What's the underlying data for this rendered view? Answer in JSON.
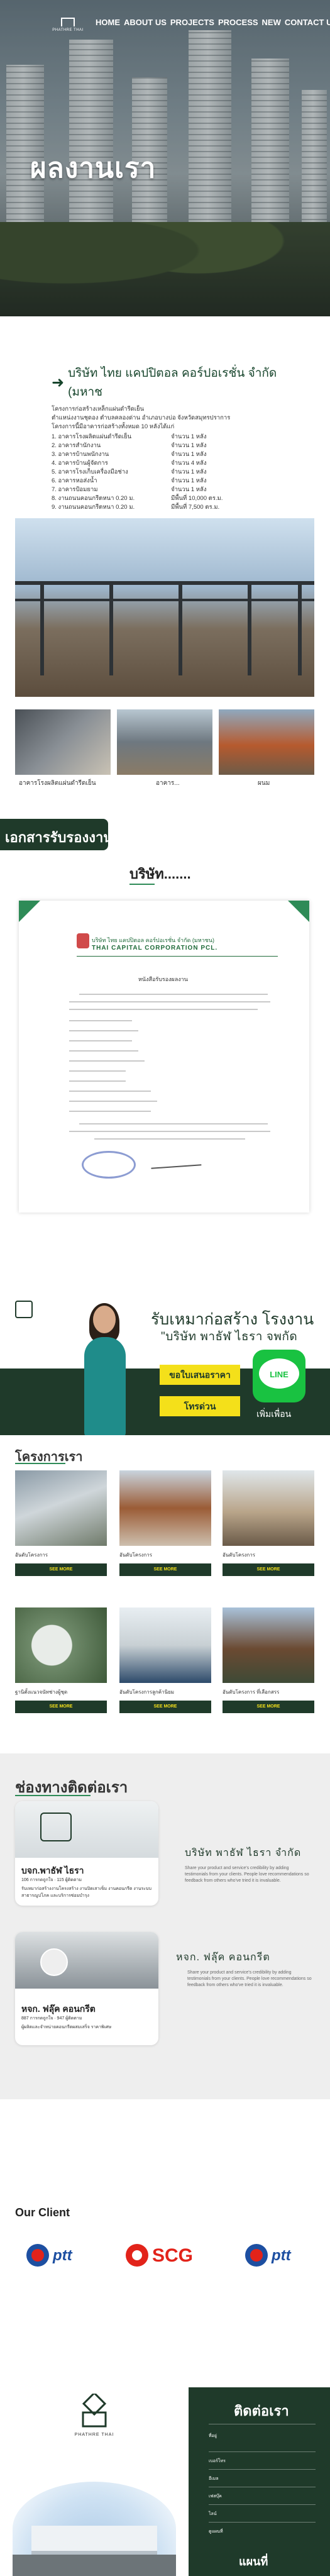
{
  "header": {
    "logo_text": "PHATHRE\nTHAI",
    "nav": [
      "HOME",
      "ABOUT US",
      "PROJECTS",
      "PROCESS",
      "NEW",
      "CONTACT US"
    ],
    "title": "ผลงานเรา"
  },
  "company": {
    "name": "บริษัท ไทย แคปปิตอล คอร์ปอเรชั่น จำกัด (มหาช",
    "lines": [
      "โครงการก่อสร้างเหล็กแผ่นดำรีดเย็น",
      "ตำแหน่งงานชุดอง ตำบลคลองด่าน อำเภอบางบ่อ จังหวัดสมุทรปราการ",
      "โครงการนี้มีอาคารก่อสร้างทั้งหมด 10 หลังได้แก่"
    ],
    "specs": [
      {
        "k": "1. อาคารโรงผลิตแผ่นดำรีดเย็น",
        "v": "จำนวน 1 หลัง"
      },
      {
        "k": "2. อาคารสำนักงาน",
        "v": "จำนวน 1 หลัง"
      },
      {
        "k": "3. อาคารบ้านพนักงาน",
        "v": "จำนวน 1 หลัง"
      },
      {
        "k": "4. อาคารบ้านผู้จัดการ",
        "v": "จำนวน 4 หลัง"
      },
      {
        "k": "5. อาคารโรงเก็บเครื่องมือช่าง",
        "v": "จำนวน 1 หลัง"
      },
      {
        "k": "6. อาคารหอส่งน้ำ",
        "v": "จำนวน 1 หลัง"
      },
      {
        "k": "7. อาคารป้อมยาม",
        "v": "จำนวน 1 หลัง"
      },
      {
        "k": "8. งานถนนคอนกรีตหนา 0.20 ม.",
        "v": "มีพื้นที่ 10,000 ตร.ม."
      },
      {
        "k": "9. งานถนนคอนกรีตหนา 0.20 ม.",
        "v": "มีพื้นที่ 7,500 ตร.ม."
      }
    ]
  },
  "gallery": {
    "captions": [
      "อาคารโรงผลิตแผ่นดำรีดเย็น",
      "อาคาร...",
      "ผนม"
    ]
  },
  "documents": {
    "banner": "เอกสารรับรองงาน",
    "subtitle": "บริษัท.......",
    "letter": {
      "company_th": "บริษัท ไทย แคปปิตอล คอร์ปอเรชั่น จำกัด (มหาชน)",
      "company_en": "THAI CAPITAL CORPORATION PCL.",
      "heading": "หนังสือรับรองผลงาน"
    }
  },
  "contact_banner": {
    "line1": "รับเหมาก่อสร้าง โรงงาน",
    "line2": "\"บริษัท พาธัฬ ไธรา จพกัด",
    "btn_quote": "ขอใบเสนอราคา",
    "btn_call": "โทรด่วน",
    "line_icon": "LINE",
    "line_sub": "เพิ่มเพื่อน"
  },
  "projects": {
    "title": "โครงการเรา",
    "btn_label": "SEE MORE",
    "items": [
      {
        "caption": "อันดับโครงการ"
      },
      {
        "caption": "อันดับโครงการ"
      },
      {
        "caption": "อันดับโครงการ"
      },
      {
        "caption": "ฐานิตั้งแนวจนัทช่างผู้ชุด"
      },
      {
        "caption": "อันดับโครงการลูกค้านิยม"
      },
      {
        "caption": "อันดับโครงการ ที่เลือกสรร"
      }
    ]
  },
  "contact_channels": {
    "title": "ช่องทางติดต่อเรา",
    "cards": [
      {
        "name": "บจก.พาธัฬ ไธรา",
        "stats": "106 การกดถูกใจ · 115 ผู้ติดตาม",
        "desc": "รับเหมาก่อสร้างงานโครงสร้าง งานปิดเสาเข็ม งานคอนกรีต งานระบบสาธารณูปโภค และบริการซ่อมบำรุง",
        "right_name": "บริษัท พาธัฬ ไธรา จำกัด",
        "right_desc": "Share your product and service's credibility by adding testimonials from your clients. People love recommendations so feedback from others who've tried it is invaluable."
      },
      {
        "name": "หจก. ฟลุ๊ค คอนกรีต",
        "stats": "887 การกดถูกใจ · 947 ผู้ติดตาม",
        "desc": "ผู้ผลิตและจำหน่ายคอนกรีตผสมเสร็จ ราคาพิเศษ",
        "right_name": "หจก. ฟลุ๊ค คอนกรีต",
        "right_desc": "Share your product and service's credibility by adding testimonials from your clients. People love recommendations so feedback from others who've tried it is invaluable."
      }
    ]
  },
  "clients": {
    "title": "Our Client",
    "logos": [
      "ptt",
      "SCG",
      "ptt"
    ]
  },
  "footer": {
    "brand": "PHATHRE THAI",
    "title": "ติดต่อเรา",
    "lines": [
      "ที่อยู่",
      "เบอร์โทร",
      "อีเมล",
      "เฟสบุ๊ค",
      "ไลน์",
      "ดูแผนที่"
    ],
    "map_label": "แผนที่"
  },
  "colors": {
    "brand_green": "#1f3a2a",
    "accent_yellow": "#f4e01a",
    "line_green": "#19c241"
  }
}
